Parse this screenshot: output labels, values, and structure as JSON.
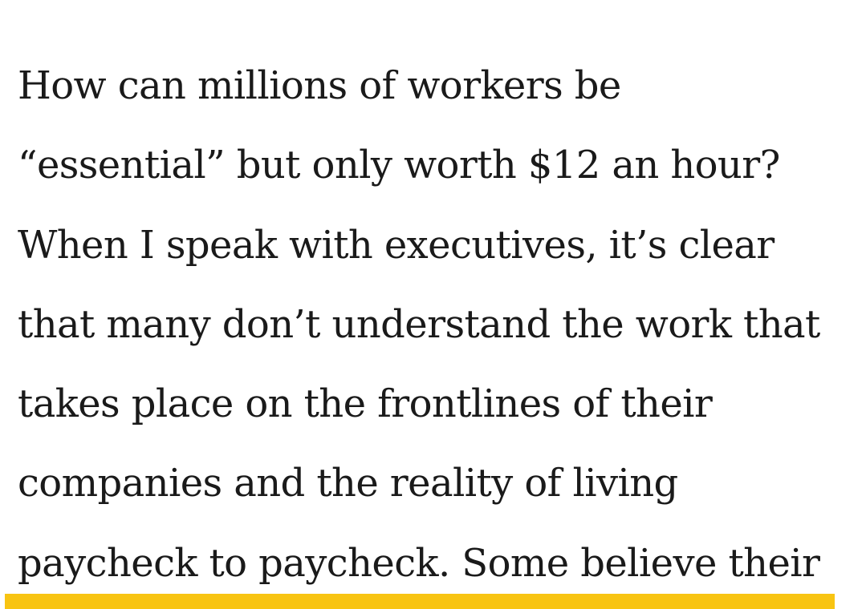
{
  "article": {
    "lines": [
      "How can millions of workers be",
      "“essential” but only worth $12 an hour?",
      "When I speak with executives, it’s clear",
      "that many don’t understand the work that",
      "takes place on the frontlines of their",
      "companies and the reality of living",
      "paycheck to paycheck. Some believe their"
    ]
  },
  "colors": {
    "text": "#1a1a1a",
    "highlight": "#f8c412",
    "background": "#ffffff"
  }
}
